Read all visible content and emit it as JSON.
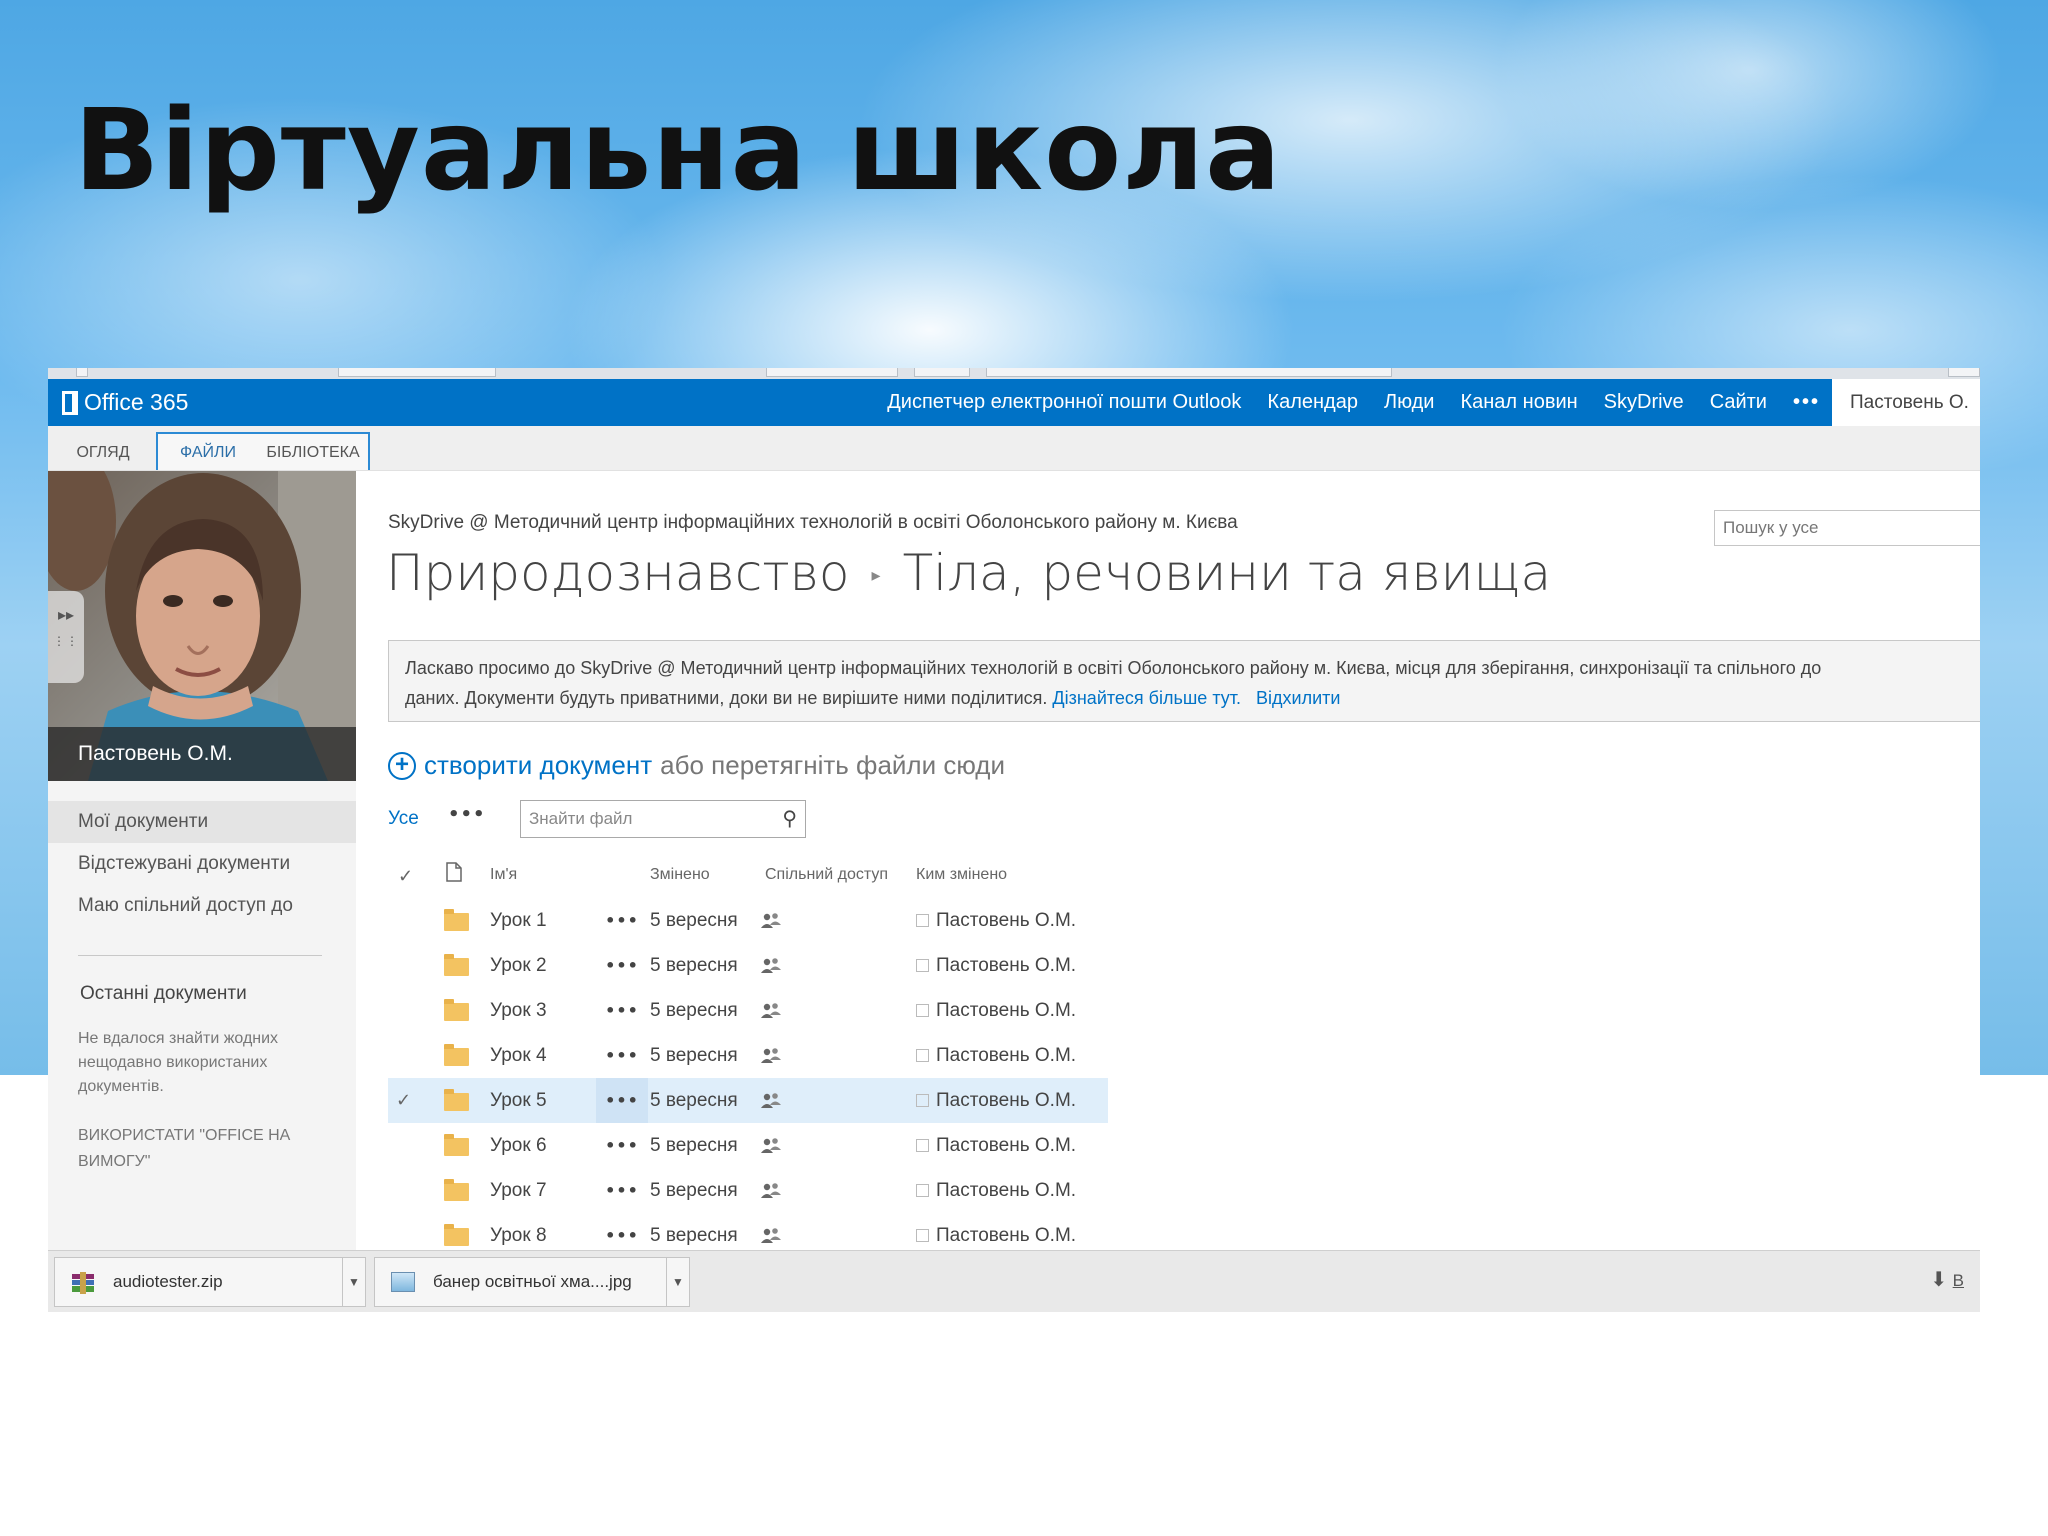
{
  "slide": {
    "title": "Віртуальна школа"
  },
  "suite_bar": {
    "logo_text": "Office 365",
    "nav": [
      "Диспетчер електронної пошти Outlook",
      "Календар",
      "Люди",
      "Канал новин",
      "SkyDrive",
      "Сайти",
      "•••"
    ],
    "user": "Пастовень О."
  },
  "ribbon": {
    "tabs": [
      "ОГЛЯД",
      "ФАЙЛИ",
      "БІБЛІОТЕКА"
    ]
  },
  "left_pane": {
    "user_name": "Пастовень О.М.",
    "nav": [
      "Мої документи",
      "Відстежувані документи",
      "Маю спільний доступ до"
    ],
    "recent_heading": "Останні документи",
    "recent_empty": "Не вдалося знайти жодних нещодавно використаних документів.",
    "office_on_demand": "ВИКОРИСТАТИ \"OFFICE НА ВИМОГУ\""
  },
  "main": {
    "site_crumb": "SkyDrive @ Методичний центр інформаційних технологій в освіті Оболонського району м. Києва",
    "breadcrumb_parent": "Природознавство",
    "breadcrumb_current": "Тіла, речовини та явища",
    "search_placeholder": "Пошук у усе",
    "welcome_line1": "Ласкаво просимо до SkyDrive @ Методичний центр інформаційних технологій в освіті Оболонського району м. Києва, місця для зберігання, синхронізації та спільного до",
    "welcome_line2": "даних. Документи будуть приватними, доки ви не вирішите ними поділитися.",
    "welcome_link_more": "Дізнайтеся більше тут.",
    "welcome_link_dismiss": "Відхилити",
    "new_doc_link": "створити документ",
    "new_doc_tail": "або перетягніть файли сюди",
    "view_all": "Усе",
    "view_more": "•••",
    "find_file_placeholder": "Знайти файл"
  },
  "table": {
    "columns": [
      "Ім'я",
      "Змінено",
      "Спільний доступ",
      "Ким змінено"
    ],
    "rows": [
      {
        "name": "Урок 1",
        "modified": "5 вересня",
        "modified_by": "Пастовень О.М.",
        "selected": false
      },
      {
        "name": "Урок 2",
        "modified": "5 вересня",
        "modified_by": "Пастовень О.М.",
        "selected": false
      },
      {
        "name": "Урок 3",
        "modified": "5 вересня",
        "modified_by": "Пастовень О.М.",
        "selected": false
      },
      {
        "name": "Урок 4",
        "modified": "5 вересня",
        "modified_by": "Пастовень О.М.",
        "selected": false
      },
      {
        "name": "Урок 5",
        "modified": "5 вересня",
        "modified_by": "Пастовень О.М.",
        "selected": true
      },
      {
        "name": "Урок 6",
        "modified": "5 вересня",
        "modified_by": "Пастовень О.М.",
        "selected": false
      },
      {
        "name": "Урок 7",
        "modified": "5 вересня",
        "modified_by": "Пастовень О.М.",
        "selected": false
      },
      {
        "name": "Урок 8",
        "modified": "5 вересня",
        "modified_by": "Пастовень О.М.",
        "selected": false
      }
    ]
  },
  "downloads": {
    "items": [
      "audiotester.zip",
      "банер освітньої хма....jpg"
    ],
    "right_label": "В"
  },
  "icons": {
    "folder": "folder-icon",
    "share": "people-icon",
    "search": "magnifier-icon",
    "plus": "plus-circle-icon",
    "download": "download-arrow-icon"
  },
  "colors": {
    "suite_blue": "#0072c6",
    "link_blue": "#0072c6",
    "selected_row": "#dfeefa"
  }
}
